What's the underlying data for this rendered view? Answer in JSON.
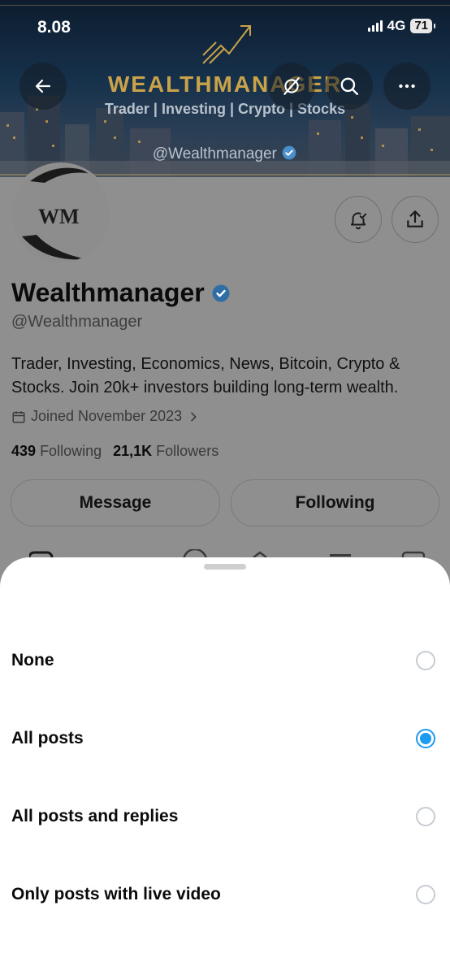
{
  "status_bar": {
    "time": "8.08",
    "network": "4G",
    "battery": "71"
  },
  "banner": {
    "title": "WEALTHMANAGER",
    "subtitle": "Trader | Investing | Crypto | Stocks",
    "handle": "@Wealthmanager"
  },
  "avatar": {
    "monogram": "WM"
  },
  "profile": {
    "name": "Wealthmanager",
    "handle": "@Wealthmanager",
    "bio": "Trader, Investing, Economics, News, Bitcoin, Crypto & Stocks. Join 20k+ investors building long-term wealth.",
    "joined": "Joined November 2023",
    "following_count": "439",
    "following_label": "Following",
    "followers_count": "21,1K",
    "followers_label": "Followers"
  },
  "actions": {
    "message": "Message",
    "following": "Following"
  },
  "sheet": {
    "options": [
      {
        "label": "None",
        "selected": false
      },
      {
        "label": "All posts",
        "selected": true
      },
      {
        "label": "All posts and replies",
        "selected": false
      },
      {
        "label": "Only posts with live video",
        "selected": false
      }
    ]
  },
  "colors": {
    "accent": "#1d9bf0",
    "banner_gold": "#c9a24a",
    "verified": "#1d9bf0"
  },
  "icons": [
    "back-arrow-icon",
    "grok-icon",
    "search-icon",
    "more-icon",
    "notification-bell-icon",
    "share-icon",
    "calendar-icon",
    "chevron-right-icon",
    "verified-badge-icon"
  ]
}
